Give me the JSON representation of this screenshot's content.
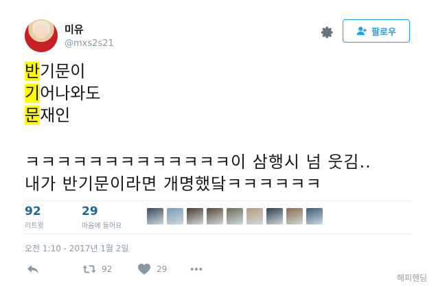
{
  "user": {
    "display_name": "미유",
    "handle": "@mxs2s21"
  },
  "follow_button": {
    "label": "팔로우"
  },
  "tweet": {
    "lines_acrostic": [
      {
        "first": "반",
        "rest": "기문이"
      },
      {
        "first": "기",
        "rest": "어나와도"
      },
      {
        "first": "문",
        "rest": "재인"
      }
    ],
    "line_a": "ㅋㅋㅋㅋㅋㅋㅋㅋㅋㅋㅋㅋㅋ이 삼행시 넘 웃김..",
    "line_b": "내가 반기문이라면 개명했닼ㅋㅋㅋㅋㅋㅋ"
  },
  "stats": {
    "retweets": {
      "count": "92",
      "label": "리트윗"
    },
    "likes": {
      "count": "29",
      "label": "마음에 들어요"
    }
  },
  "liker_avatar_colors": [
    "#3a4a5c",
    "#7a9ab8",
    "#4a3a2e",
    "#5b4636",
    "#6b6b5a",
    "#b89a7a",
    "#2c3e50",
    "#8a6a4a",
    "#3c5a78"
  ],
  "timestamp": "오전 1:10 - 2017년 1월 2일",
  "actions": {
    "retweet_count": "92",
    "like_count": "29"
  },
  "watermark": "해피헨딩",
  "colors": {
    "accent": "#1da1f2",
    "stat_number": "#1b6695",
    "highlight": "#ffff00"
  }
}
